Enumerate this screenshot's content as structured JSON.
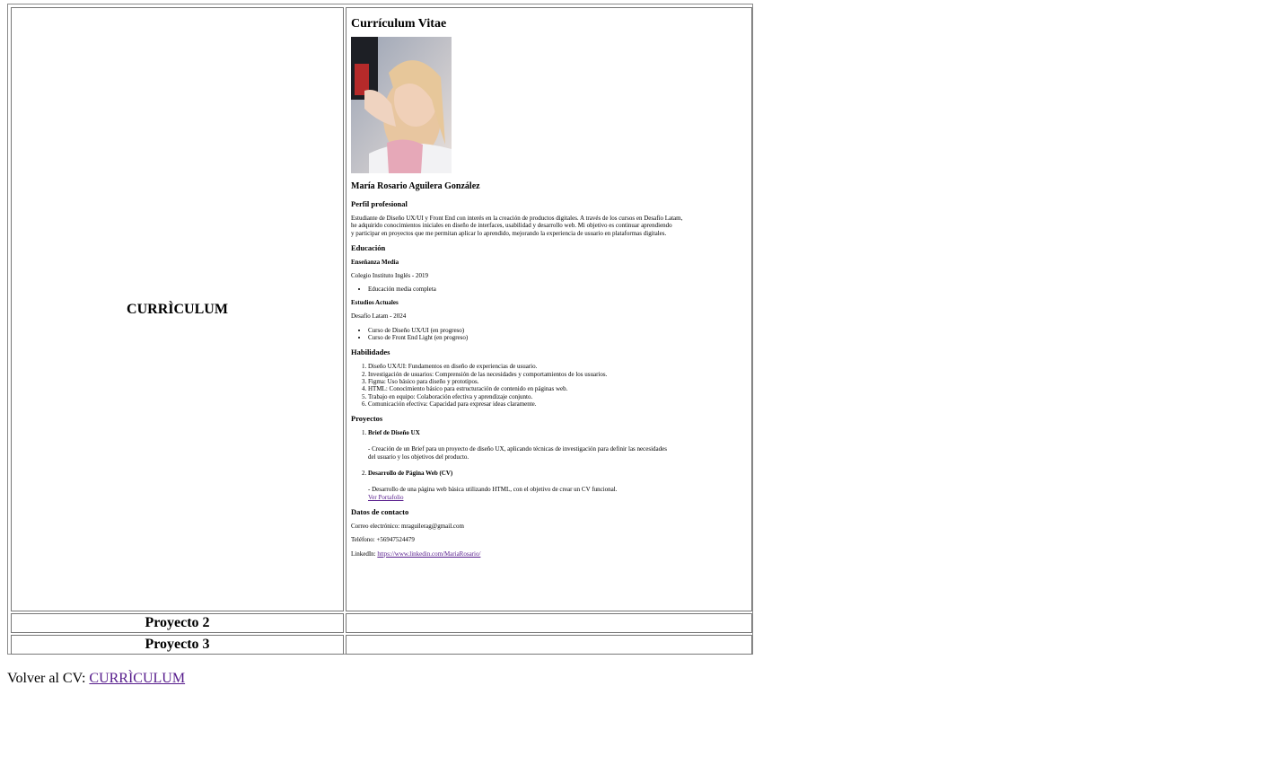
{
  "table": {
    "row1_header": "CURRÌCULUM",
    "row2_header": "Proyecto 2",
    "row3_header": "Proyecto 3"
  },
  "cv": {
    "title": "Currículum Vitae",
    "name": "María Rosario Aguilera González",
    "perfil_heading": "Perfil profesional",
    "perfil_line1": "Estudiante de Diseño UX/UI y Front End con interés en la creación de productos digitales. A través de los cursos en Desafío Latam,",
    "perfil_line2": "he adquirido conocimientos iniciales en diseño de interfaces, usabilidad y desarrollo web. Mi objetivo es continuar aprendiendo",
    "perfil_line3": "y participar en proyectos que me permitan aplicar lo aprendido, mejorando la experiencia de usuario en plataformas digitales.",
    "educacion_heading": "Educación",
    "media_heading": "Enseñanza Media",
    "media_school": "Colegio Instituto Inglés - 2019",
    "media_items": [
      "Educación media completa"
    ],
    "actuales_heading": "Estudios Actuales",
    "actuales_school": "Desafío Latam - 2024",
    "actuales_items": [
      "Curso de Diseño UX/UI (en progreso)",
      "Curso de Front End Light (en progreso)"
    ],
    "habilidades_heading": "Habilidades",
    "habilidades": [
      "Diseño UX/UI: Fundamentos en diseño de experiencias de usuario.",
      "Investigación de usuarios: Comprensión de las necesidades y comportamientos de los usuarios.",
      "Figma: Uso básico para diseño y prototipos.",
      "HTML: Conocimiento básico para estructuración de contenido en páginas web.",
      "Trabajo en equipo: Colaboración efectiva y aprendizaje conjunto.",
      "Comunicación efectiva: Capacidad para expresar ideas claramente."
    ],
    "proyectos_heading": "Proyectos",
    "proyecto1_title": "Brief de Diseño UX",
    "proyecto1_desc1": "- Creación de un Brief para un proyecto de diseño UX, aplicando técnicas de investigación para definir las necesidades",
    "proyecto1_desc2": "del usuario y los objetivos del producto.",
    "proyecto2_title": "Desarrollo de Página Web (CV)",
    "proyecto2_desc": "- Desarrollo de una página web básica utilizando HTML, con el objetivo de crear un CV funcional.",
    "portfolio_link": "Ver Portafolio",
    "contacto_heading": "Datos de contacto",
    "email": "Correo electrónico: mraguilerag@gmail.com",
    "telefono": "Teléfono: +56947524479",
    "linkedin_label": "LinkedIn: ",
    "linkedin_url": "https://www.linkedin.com/MariaRosario/"
  },
  "footer": {
    "label": "Volver al CV: ",
    "link": "CURRÌCULUM"
  }
}
